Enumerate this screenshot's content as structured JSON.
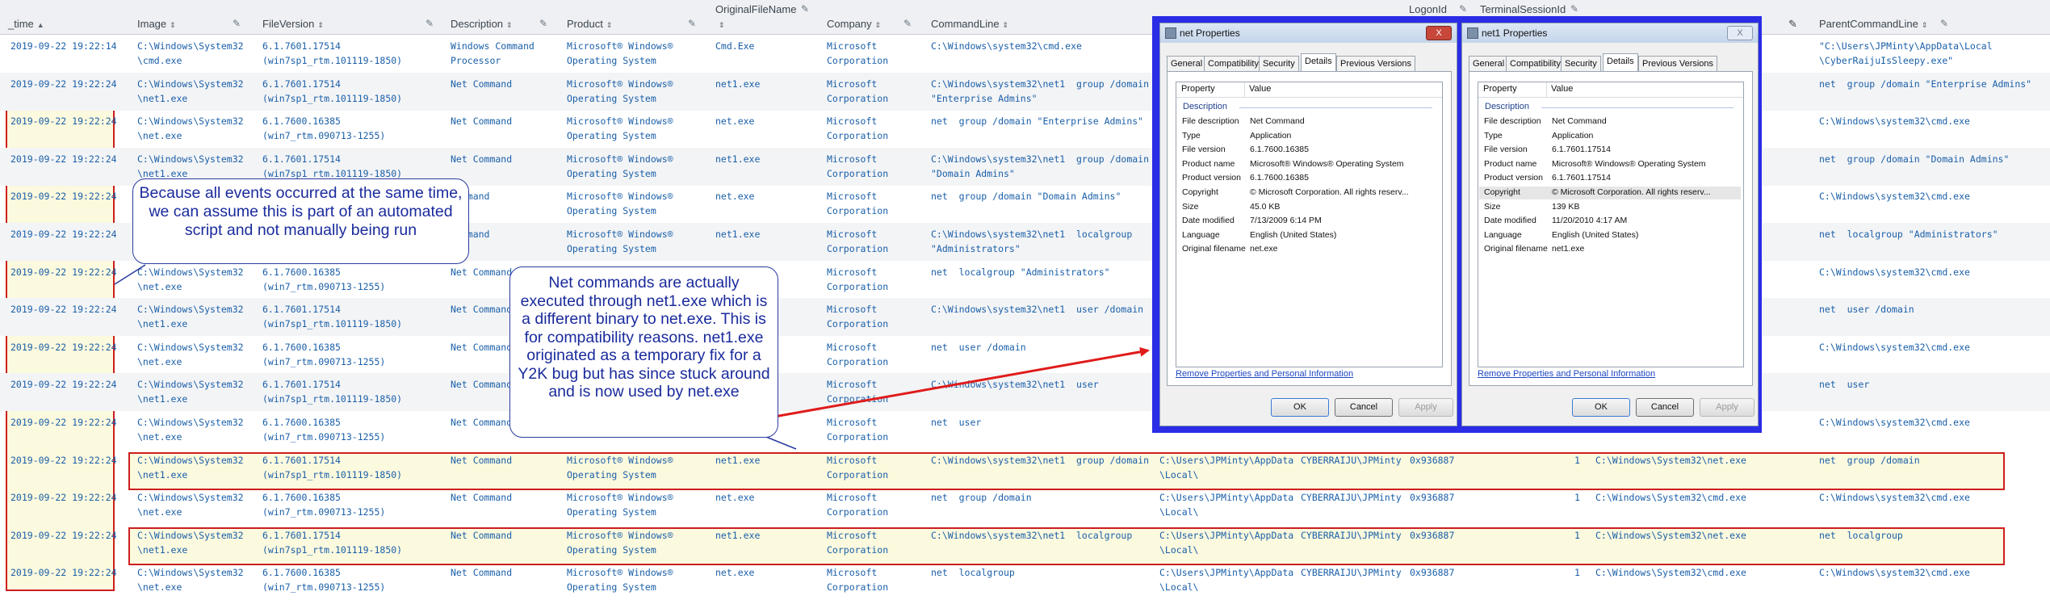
{
  "columns": {
    "time": "_time",
    "image": "Image",
    "file_version": "FileVersion",
    "description": "Description",
    "product": "Product",
    "original_file_name": "OriginalFileName",
    "company": "Company",
    "command_line": "CommandLine",
    "logon_id": "LogonId",
    "terminal_session_id": "TerminalSessionId",
    "parent_command_line": "ParentCommandLine"
  },
  "rows": [
    {
      "time": "2019-09-22 19:22:14",
      "image": "C:\\Windows\\System32\n\\cmd.exe",
      "ver": "6.1.7601.17514\n(win7sp1_rtm.101119-1850)",
      "desc": "Windows Command\nProcessor",
      "prod": "Microsoft® Windows®\nOperating System",
      "orig": "Cmd.Exe",
      "comp": "Microsoft\nCorporation",
      "cmd": "C:\\Windows\\system32\\cmd.exe",
      "cwd": "",
      "user": "",
      "logon": "",
      "sess": "",
      "pimage": "",
      "pcmd": "\"C:\\Users\\JPMinty\\AppData\\Local\n\\CyberRaijuIsSleepy.exe\""
    },
    {
      "time": "2019-09-22 19:22:24",
      "image": "C:\\Windows\\System32\n\\net1.exe",
      "ver": "6.1.7601.17514\n(win7sp1_rtm.101119-1850)",
      "desc": "Net Command",
      "prod": "Microsoft® Windows®\nOperating System",
      "orig": "net1.exe",
      "comp": "Microsoft\nCorporation",
      "cmd": "C:\\Windows\\system32\\net1  group /domain\n\"Enterprise Admins\"",
      "cwd": "",
      "user": "",
      "logon": "",
      "sess": "",
      "pimage": "",
      "pcmd": "net  group /domain \"Enterprise Admins\""
    },
    {
      "time": "2019-09-22 19:22:24",
      "image": "C:\\Windows\\System32\n\\net.exe",
      "ver": "6.1.7600.16385\n(win7_rtm.090713-1255)",
      "desc": "Net Command",
      "prod": "Microsoft® Windows®\nOperating System",
      "orig": "net.exe",
      "comp": "Microsoft\nCorporation",
      "cmd": "net  group /domain \"Enterprise Admins\"",
      "cwd": "",
      "user": "",
      "logon": "",
      "sess": "",
      "pimage": "",
      "pcmd": "C:\\Windows\\system32\\cmd.exe"
    },
    {
      "time": "2019-09-22 19:22:24",
      "image": "C:\\Windows\\System32\n\\net1.exe",
      "ver": "6.1.7601.17514\n(win7sp1_rtm.101119-1850)",
      "desc": "Net Command",
      "prod": "Microsoft® Windows®\nOperating System",
      "orig": "net1.exe",
      "comp": "Microsoft\nCorporation",
      "cmd": "C:\\Windows\\system32\\net1  group /domain\n\"Domain Admins\"",
      "cwd": "",
      "user": "",
      "logon": "",
      "sess": "",
      "pimage": "",
      "pcmd": "net  group /domain \"Domain Admins\""
    },
    {
      "time": "2019-09-22 19:22:24",
      "image": "",
      "ver": "",
      "desc": "Command",
      "prod": "Microsoft® Windows®\nOperating System",
      "orig": "net.exe",
      "comp": "Microsoft\nCorporation",
      "cmd": "net  group /domain \"Domain Admins\"",
      "cwd": "",
      "user": "",
      "logon": "",
      "sess": "",
      "pimage": "",
      "pcmd": "C:\\Windows\\system32\\cmd.exe"
    },
    {
      "time": "2019-09-22 19:22:24",
      "image": "",
      "ver": "",
      "desc": "Command",
      "prod": "Microsoft® Windows®\nOperating System",
      "orig": "net1.exe",
      "comp": "Microsoft\nCorporation",
      "cmd": "C:\\Windows\\system32\\net1  localgroup\n\"Administrators\"",
      "cwd": "",
      "user": "",
      "logon": "",
      "sess": "",
      "pimage": "",
      "pcmd": "net  localgroup \"Administrators\""
    },
    {
      "time": "2019-09-22 19:22:24",
      "image": "C:\\Windows\\System32\n\\net.exe",
      "ver": "6.1.7600.16385\n(win7_rtm.090713-1255)",
      "desc": "Net Command",
      "prod": "",
      "orig": "",
      "comp": "Microsoft\nCorporation",
      "cmd": "net  localgroup \"Administrators\"",
      "cwd": "",
      "user": "",
      "logon": "",
      "sess": "",
      "pimage": "",
      "pcmd": "C:\\Windows\\system32\\cmd.exe"
    },
    {
      "time": "2019-09-22 19:22:24",
      "image": "C:\\Windows\\System32\n\\net1.exe",
      "ver": "6.1.7601.17514\n(win7sp1_rtm.101119-1850)",
      "desc": "Net Command",
      "prod": "",
      "orig": "",
      "comp": "Microsoft\nCorporation",
      "cmd": "C:\\Windows\\system32\\net1  user /domain",
      "cwd": "",
      "user": "",
      "logon": "",
      "sess": "",
      "pimage": "",
      "pcmd": "net  user /domain"
    },
    {
      "time": "2019-09-22 19:22:24",
      "image": "C:\\Windows\\System32\n\\net.exe",
      "ver": "6.1.7600.16385\n(win7_rtm.090713-1255)",
      "desc": "Net Command",
      "prod": "",
      "orig": "",
      "comp": "Microsoft\nCorporation",
      "cmd": "net  user /domain",
      "cwd": "",
      "user": "",
      "logon": "",
      "sess": "",
      "pimage": "",
      "pcmd": "C:\\Windows\\system32\\cmd.exe"
    },
    {
      "time": "2019-09-22 19:22:24",
      "image": "C:\\Windows\\System32\n\\net1.exe",
      "ver": "6.1.7601.17514\n(win7sp1_rtm.101119-1850)",
      "desc": "Net Command",
      "prod": "",
      "orig": "",
      "comp": "Microsoft\nCorporation",
      "cmd": "C:\\Windows\\system32\\net1  user",
      "cwd": "",
      "user": "",
      "logon": "",
      "sess": "",
      "pimage": "",
      "pcmd": "net  user"
    },
    {
      "time": "2019-09-22 19:22:24",
      "image": "C:\\Windows\\System32\n\\net.exe",
      "ver": "6.1.7600.16385\n(win7_rtm.090713-1255)",
      "desc": "Net Command",
      "prod": "",
      "orig": "",
      "comp": "Microsoft\nCorporation",
      "cmd": "net  user",
      "cwd": "\\Local\\",
      "user": "",
      "logon": "",
      "sess": "",
      "pimage": "",
      "pcmd": "C:\\Windows\\system32\\cmd.exe"
    },
    {
      "time": "2019-09-22 19:22:24",
      "image": "C:\\Windows\\System32\n\\net1.exe",
      "ver": "6.1.7601.17514\n(win7sp1_rtm.101119-1850)",
      "desc": "Net Command",
      "prod": "Microsoft® Windows®\nOperating System",
      "orig": "net1.exe",
      "comp": "Microsoft\nCorporation",
      "cmd": "C:\\Windows\\system32\\net1  group /domain",
      "cwd": "C:\\Users\\JPMinty\\AppData\n\\Local\\",
      "user": "CYBERRAIJU\\JPMinty",
      "logon": "0x936887",
      "sess": "1",
      "pimage": "C:\\Windows\\System32\\net.exe",
      "pcmd": "net  group /domain"
    },
    {
      "time": "2019-09-22 19:22:24",
      "image": "C:\\Windows\\System32\n\\net.exe",
      "ver": "6.1.7600.16385\n(win7_rtm.090713-1255)",
      "desc": "Net Command",
      "prod": "Microsoft® Windows®\nOperating System",
      "orig": "net.exe",
      "comp": "Microsoft\nCorporation",
      "cmd": "net  group /domain",
      "cwd": "C:\\Users\\JPMinty\\AppData\n\\Local\\",
      "user": "CYBERRAIJU\\JPMinty",
      "logon": "0x936887",
      "sess": "1",
      "pimage": "C:\\Windows\\System32\\cmd.exe",
      "pcmd": "C:\\Windows\\system32\\cmd.exe"
    },
    {
      "time": "2019-09-22 19:22:24",
      "image": "C:\\Windows\\System32\n\\net1.exe",
      "ver": "6.1.7601.17514\n(win7sp1_rtm.101119-1850)",
      "desc": "Net Command",
      "prod": "Microsoft® Windows®\nOperating System",
      "orig": "net1.exe",
      "comp": "Microsoft\nCorporation",
      "cmd": "C:\\Windows\\system32\\net1  localgroup",
      "cwd": "C:\\Users\\JPMinty\\AppData\n\\Local\\",
      "user": "CYBERRAIJU\\JPMinty",
      "logon": "0x936887",
      "sess": "1",
      "pimage": "C:\\Windows\\System32\\net.exe",
      "pcmd": "net  localgroup"
    },
    {
      "time": "2019-09-22 19:22:24",
      "image": "C:\\Windows\\System32\n\\net.exe",
      "ver": "6.1.7600.16385\n(win7_rtm.090713-1255)",
      "desc": "Net Command",
      "prod": "Microsoft® Windows®\nOperating System",
      "orig": "net.exe",
      "comp": "Microsoft\nCorporation",
      "cmd": "net  localgroup",
      "cwd": "C:\\Users\\JPMinty\\AppData\n\\Local\\",
      "user": "CYBERRAIJU\\JPMinty",
      "logon": "0x936887",
      "sess": "1",
      "pimage": "C:\\Windows\\System32\\cmd.exe",
      "pcmd": "C:\\Windows\\system32\\cmd.exe"
    }
  ],
  "callouts": {
    "time_note": "Because all events occurred at the same time, we can assume this is part of an automated script and not manually being run",
    "net1_note": "Net commands are actually executed through net1.exe which is a different binary to net.exe. This is for compatibility reasons. net1.exe originated as a temporary fix for a Y2K bug but has since stuck around and is now used by net.exe"
  },
  "dialog_net": {
    "title": "net Properties",
    "tabs": [
      "General",
      "Compatibility",
      "Security",
      "Details",
      "Previous Versions"
    ],
    "active_tab": "Details",
    "col_property": "Property",
    "col_value": "Value",
    "section": "Description",
    "rows": [
      {
        "k": "File description",
        "v": "Net Command"
      },
      {
        "k": "Type",
        "v": "Application"
      },
      {
        "k": "File version",
        "v": "6.1.7600.16385"
      },
      {
        "k": "Product name",
        "v": "Microsoft® Windows® Operating System"
      },
      {
        "k": "Product version",
        "v": "6.1.7600.16385"
      },
      {
        "k": "Copyright",
        "v": "© Microsoft Corporation. All rights reserv..."
      },
      {
        "k": "Size",
        "v": "45.0 KB"
      },
      {
        "k": "Date modified",
        "v": "7/13/2009 6:14 PM"
      },
      {
        "k": "Language",
        "v": "English (United States)"
      },
      {
        "k": "Original filename",
        "v": "net.exe"
      }
    ],
    "link": "Remove Properties and Personal Information",
    "ok": "OK",
    "cancel": "Cancel",
    "apply": "Apply",
    "close": "X"
  },
  "dialog_net1": {
    "title": "net1 Properties",
    "tabs": [
      "General",
      "Compatibility",
      "Security",
      "Details",
      "Previous Versions"
    ],
    "active_tab": "Details",
    "col_property": "Property",
    "col_value": "Value",
    "section": "Description",
    "rows": [
      {
        "k": "File description",
        "v": "Net Command"
      },
      {
        "k": "Type",
        "v": "Application"
      },
      {
        "k": "File version",
        "v": "6.1.7601.17514"
      },
      {
        "k": "Product name",
        "v": "Microsoft® Windows® Operating System"
      },
      {
        "k": "Product version",
        "v": "6.1.7601.17514"
      },
      {
        "k": "Copyright",
        "v": "© Microsoft Corporation. All rights reserv..."
      },
      {
        "k": "Size",
        "v": "139 KB"
      },
      {
        "k": "Date modified",
        "v": "11/20/2010 4:17 AM"
      },
      {
        "k": "Language",
        "v": "English (United States)"
      },
      {
        "k": "Original filename",
        "v": "net1.exe"
      }
    ],
    "link": "Remove Properties and Personal Information",
    "ok": "OK",
    "cancel": "Cancel",
    "apply": "Apply",
    "close": "X"
  },
  "colors": {
    "link_text": "#1a5fa8",
    "highlight_border": "#cc1f1f",
    "highlight_fill": "#fbf9de",
    "callout_text": "#1a2b9c",
    "dialog_frame": "#2a2ce6",
    "arrow": "#e01b1b"
  }
}
